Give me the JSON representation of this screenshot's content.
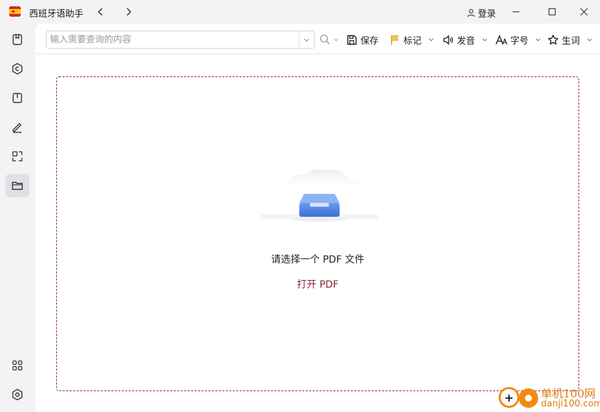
{
  "app": {
    "title": "西班牙语助手",
    "login_label": "登录"
  },
  "sidebar": {
    "top_items": [
      {
        "icon": "bookmark-icon"
      },
      {
        "icon": "copyright-icon"
      },
      {
        "icon": "book-icon"
      },
      {
        "icon": "pen-icon"
      },
      {
        "icon": "scan-document-icon"
      },
      {
        "icon": "folder-icon",
        "active": true
      }
    ],
    "bottom_items": [
      {
        "icon": "apps-grid-icon"
      },
      {
        "icon": "settings-hex-icon"
      }
    ]
  },
  "toolbar": {
    "search_placeholder": "输入需要查询的内容",
    "save_label": "保存",
    "mark_label": "标记",
    "voice_label": "发音",
    "font_label": "字号",
    "vocab_label": "生词"
  },
  "content": {
    "prompt": "请选择一个 PDF 文件",
    "open_link": "打开 PDF"
  },
  "watermark": {
    "text": "单机100网",
    "domain": "danji100.com"
  },
  "colors": {
    "accent": "#8a2334",
    "dashed_border": "#8e2a3a",
    "mark_flag": "#f0b429",
    "illustration_blue": "#4a7ee0"
  }
}
